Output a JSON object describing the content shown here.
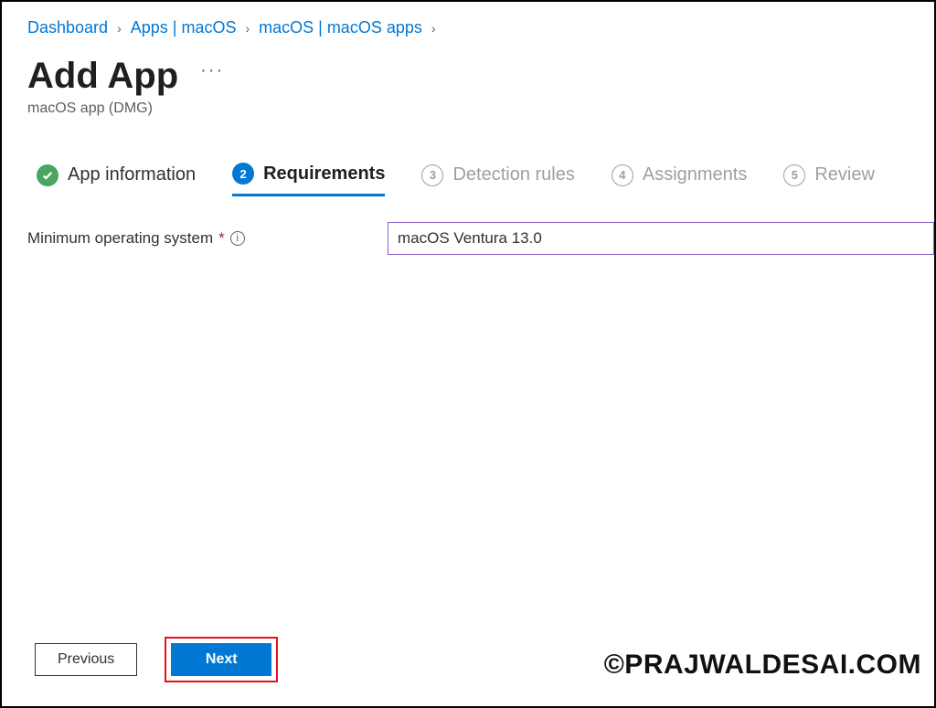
{
  "breadcrumb": {
    "items": [
      "Dashboard",
      "Apps | macOS",
      "macOS | macOS apps"
    ]
  },
  "header": {
    "title": "Add App",
    "subtitle": "macOS app (DMG)"
  },
  "tabs": {
    "t1": {
      "label": "App information"
    },
    "t2": {
      "num": "2",
      "label": "Requirements"
    },
    "t3": {
      "num": "3",
      "label": "Detection rules"
    },
    "t4": {
      "num": "4",
      "label": "Assignments"
    },
    "t5": {
      "num": "5",
      "label": "Review"
    }
  },
  "form": {
    "min_os_label": "Minimum operating system",
    "min_os_value": "macOS Ventura 13.0"
  },
  "footer": {
    "previous": "Previous",
    "next": "Next"
  },
  "watermark": "©PRAJWALDESAI.COM"
}
